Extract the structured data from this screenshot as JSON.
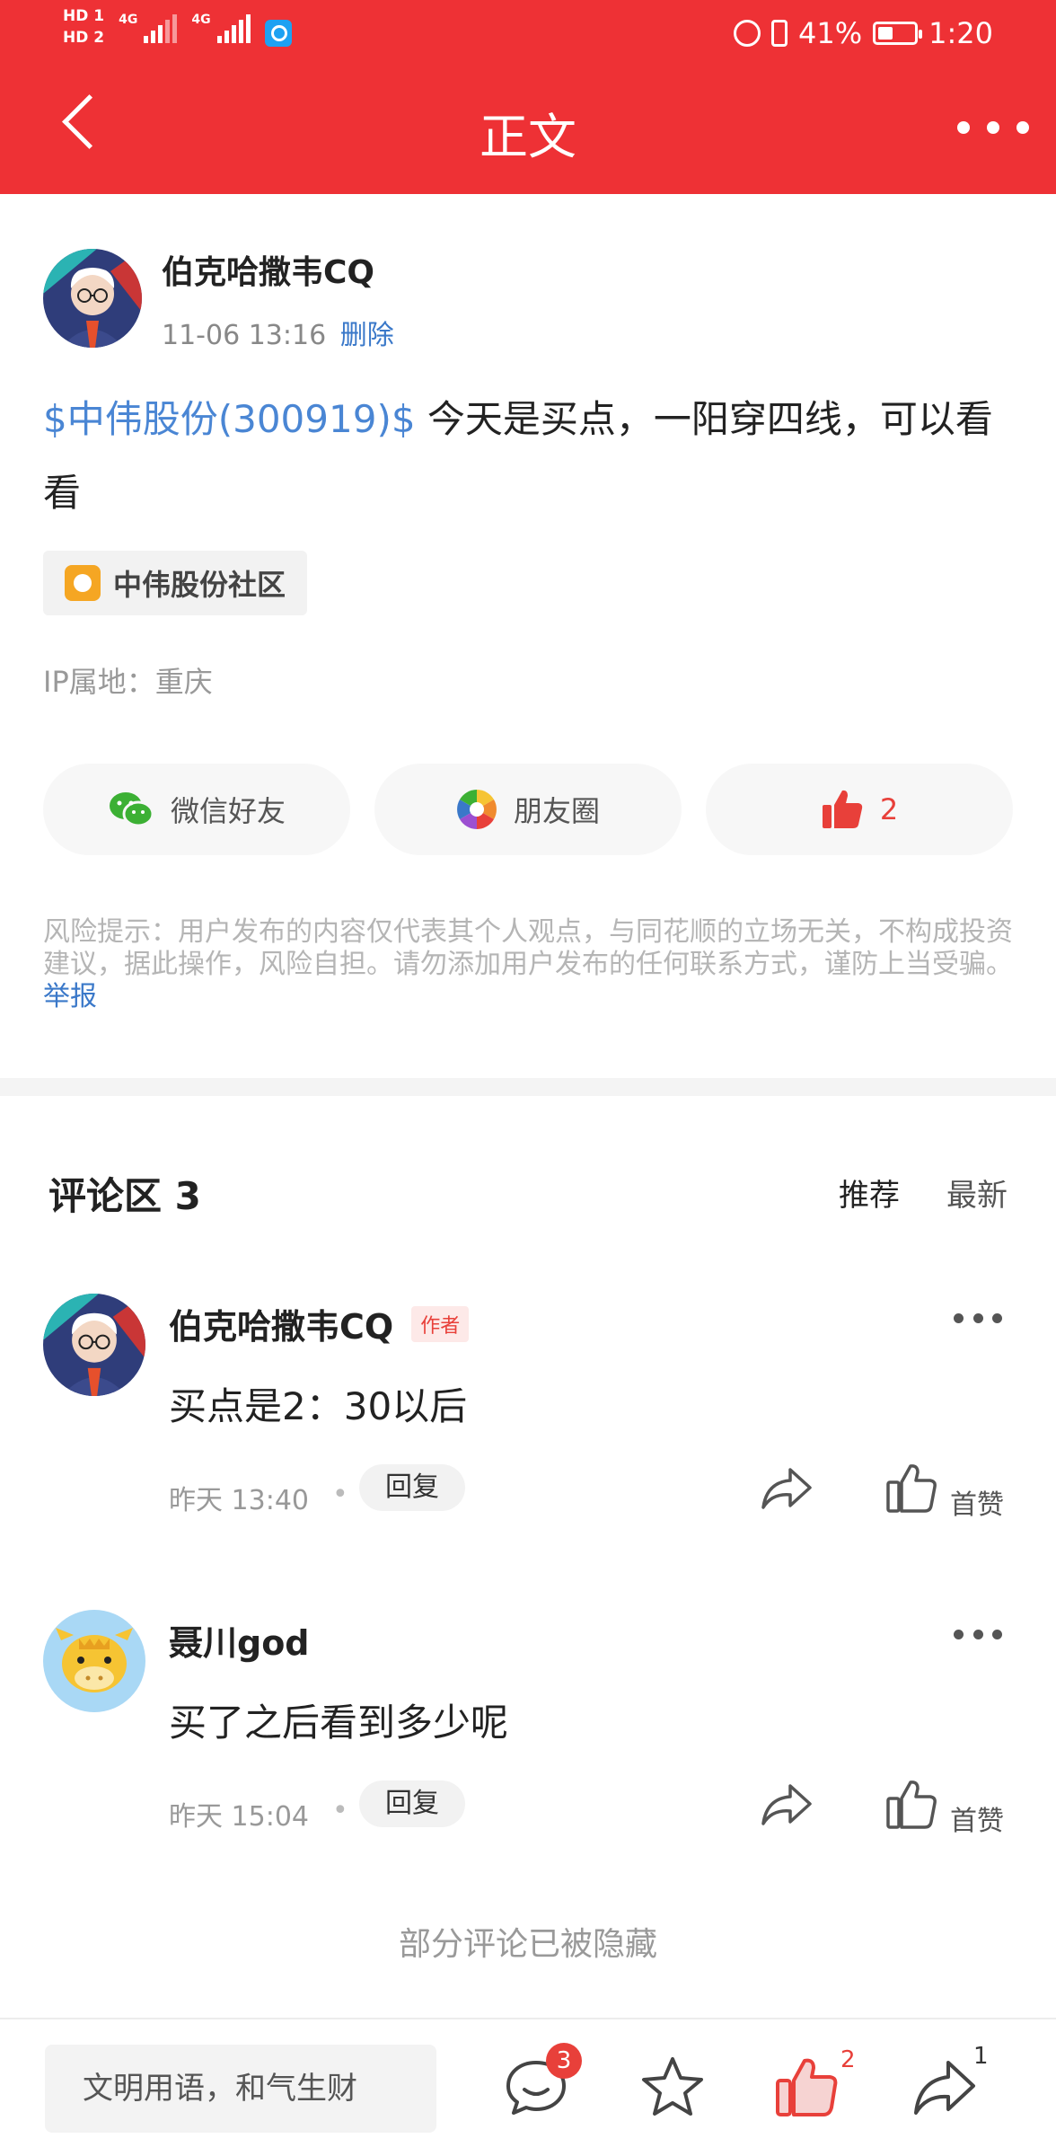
{
  "status_bar": {
    "hd1": "HD 1",
    "hd2": "HD 2",
    "net1": "4G",
    "net2": "4G",
    "battery_text": "41%",
    "battery_level": 0.41,
    "time": "1:20"
  },
  "header": {
    "title": "正文",
    "bg_color": "#ee3135"
  },
  "post": {
    "author": "伯克哈撒韦CQ",
    "time": "11-06 13:16",
    "delete_label": "删除",
    "stock_tag": "$中伟股份(300919)$",
    "text": " 今天是买点，一阳穿四线，可以看看",
    "community": "中伟股份社区",
    "ip_location": "IP属地：重庆",
    "share": {
      "wechat_label": "微信好友",
      "moments_label": "朋友圈",
      "like_count": "2"
    },
    "risk_text": "风险提示：用户发布的内容仅代表其个人观点，与同花顺的立场无关，不构成投资建议，据此操作，风险自担。请勿添加用户发布的任何联系方式，谨防上当受骗。",
    "report_label": "举报"
  },
  "comments_section": {
    "title": "评论区 3",
    "sort_recommend": "推荐",
    "sort_latest": "最新",
    "items": [
      {
        "name": "伯克哈撒韦CQ",
        "badge": "作者",
        "text": "买点是2：30以后",
        "time": "昨天 13:40",
        "dot": "•",
        "reply_label": "回复",
        "like_label": "首赞"
      },
      {
        "name": "聂川god",
        "text": "买了之后看到多少呢",
        "time": "昨天 15:04",
        "dot": "•",
        "reply_label": "回复",
        "like_label": "首赞"
      }
    ],
    "hidden_note": "部分评论已被隐藏"
  },
  "bottom_bar": {
    "input_placeholder": "文明用语，和气生财",
    "comment_count": "3",
    "like_count": "2",
    "share_count": "1"
  }
}
